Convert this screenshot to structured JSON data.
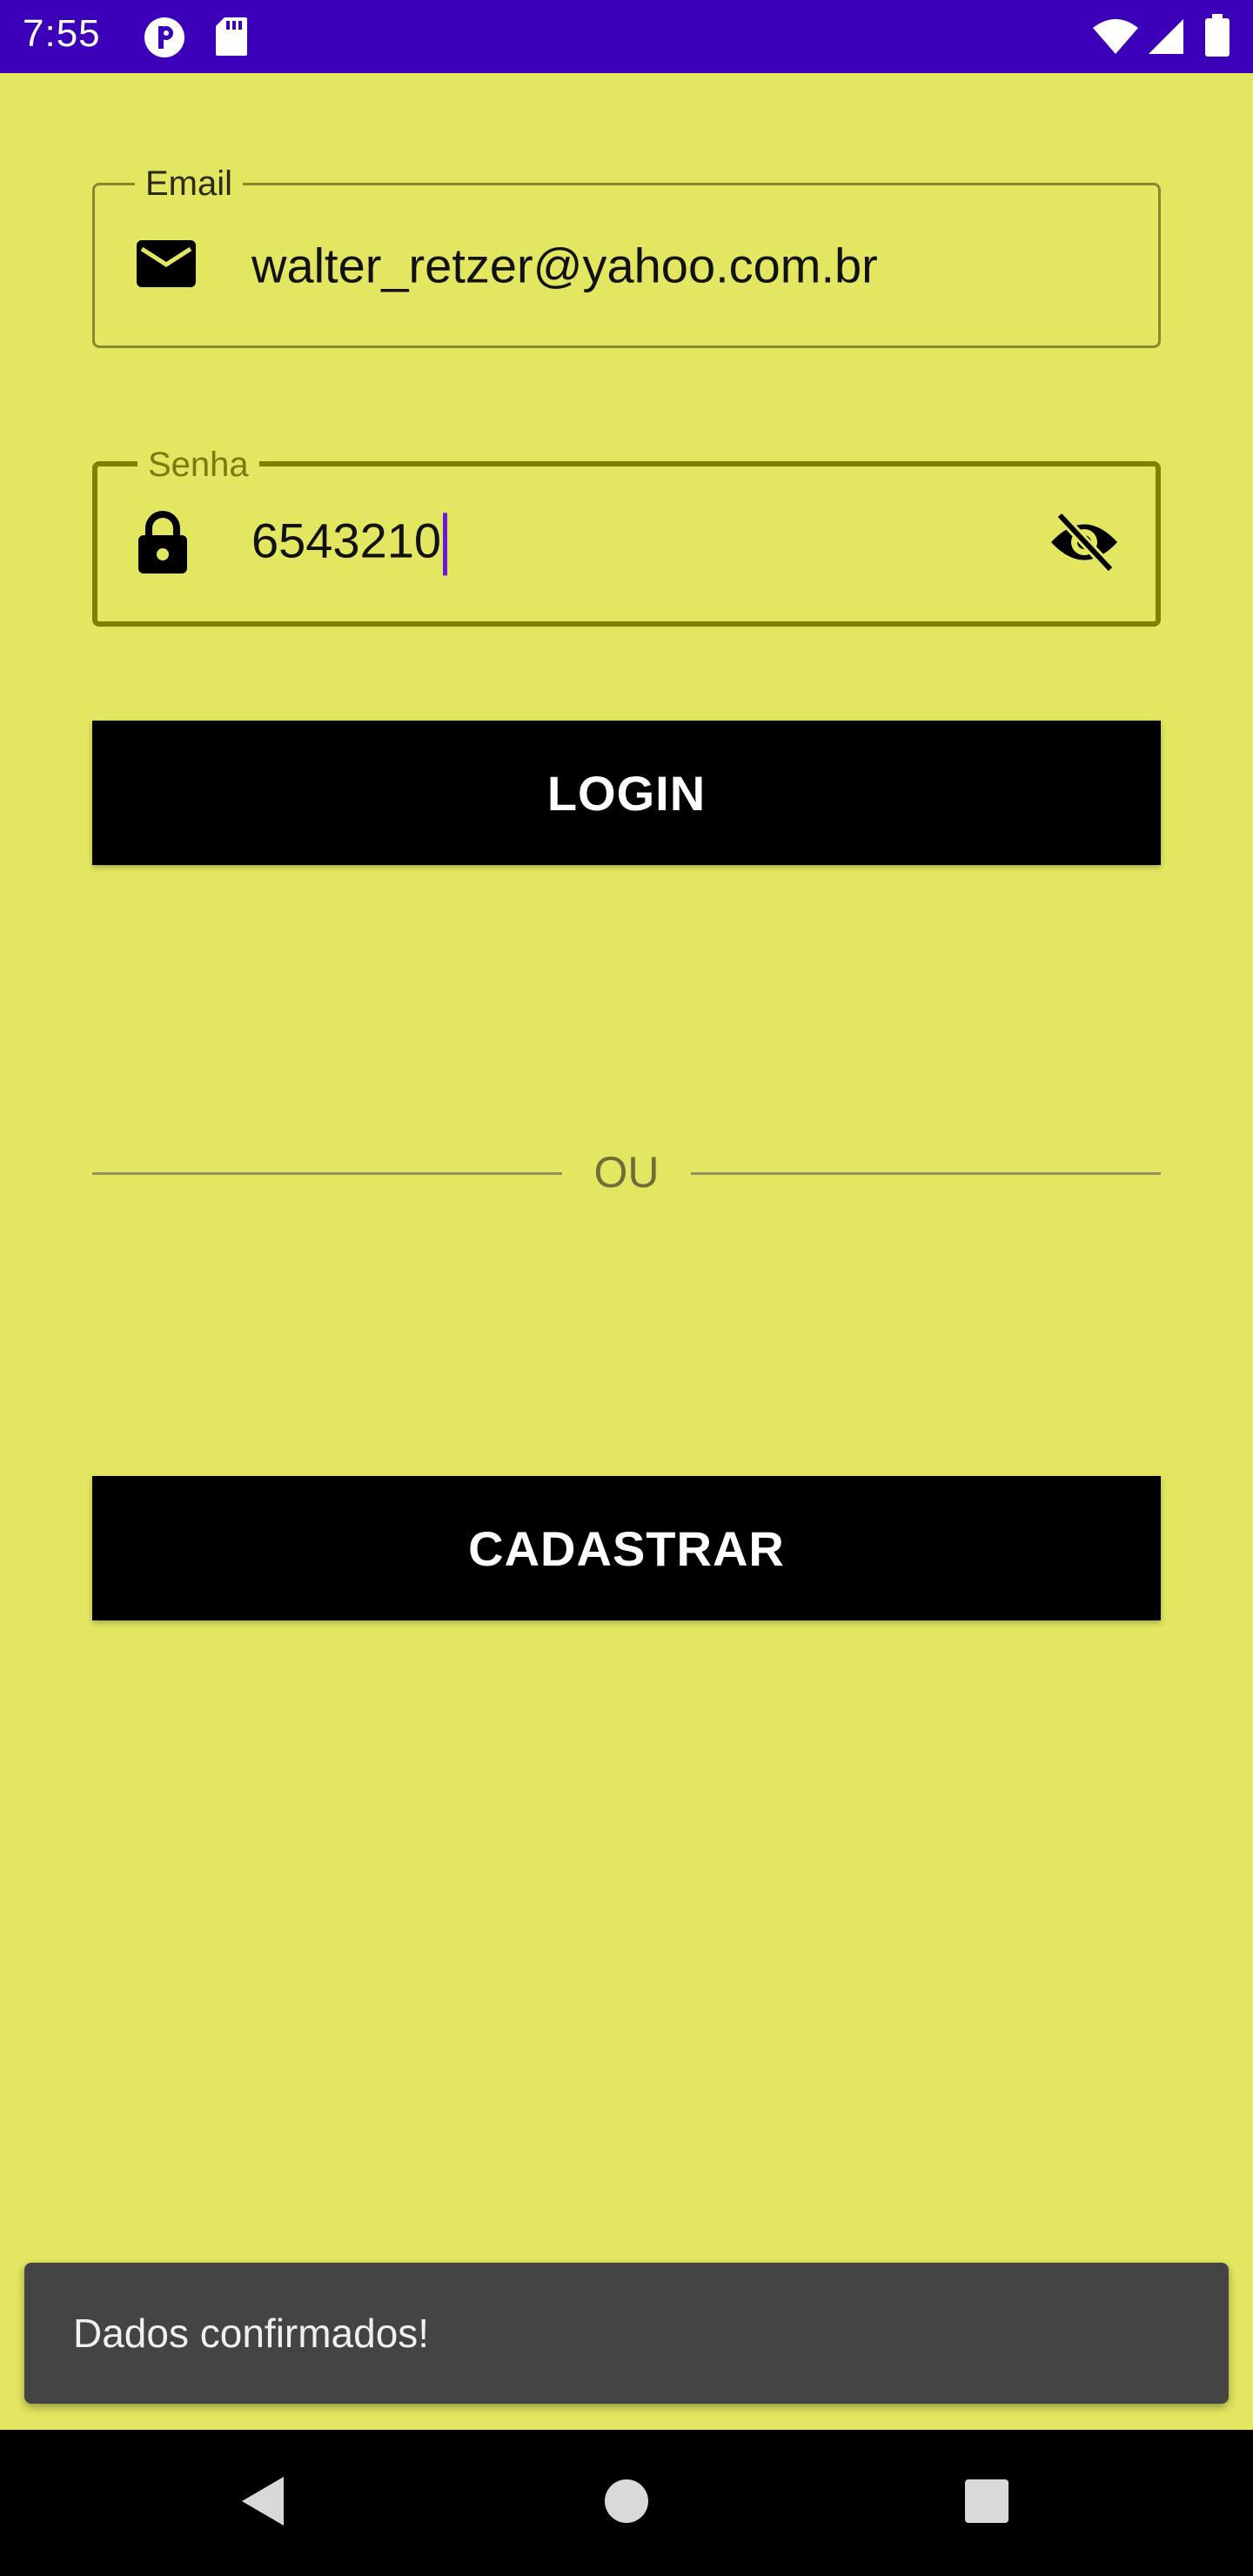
{
  "status_bar": {
    "time": "7:55",
    "icons": [
      "notification-app-icon",
      "sd-card-icon",
      "wifi-icon",
      "signal-icon",
      "battery-icon"
    ],
    "background": "#3b00b8"
  },
  "form": {
    "email": {
      "label": "Email",
      "value": "walter_retzer@yahoo.com.br",
      "icon": "envelope-icon"
    },
    "password": {
      "label": "Senha",
      "value": "6543210",
      "icon": "lock-icon",
      "toggle_icon": "visibility-off-icon",
      "focused": true
    },
    "login_label": "LOGIN",
    "divider_text": "OU",
    "signup_label": "CADASTRAR"
  },
  "snackbar": {
    "message": "Dados confirmados!"
  },
  "nav_bar": {
    "buttons": [
      "back-icon",
      "home-icon",
      "recents-icon"
    ]
  },
  "colors": {
    "background": "#e3e661",
    "accent": "#808000",
    "button": "#000000",
    "cursor": "#6a18d8",
    "snackbar": "#444444"
  }
}
